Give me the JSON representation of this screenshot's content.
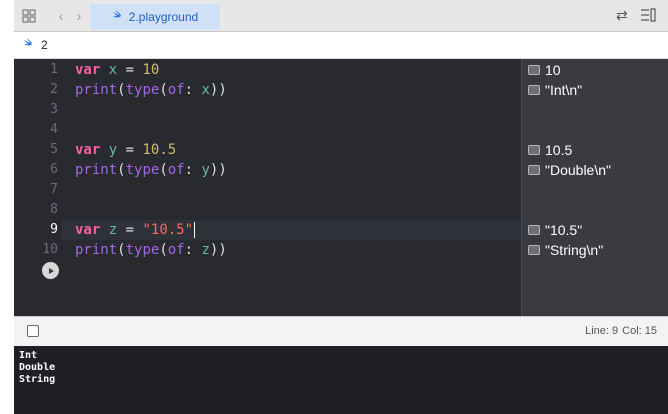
{
  "tab": {
    "title": "2.playground"
  },
  "breadcrumb": {
    "label": "2"
  },
  "editor": {
    "line_numbers": [
      "1",
      "2",
      "3",
      "4",
      "5",
      "6",
      "7",
      "8",
      "9",
      "10"
    ],
    "current_line": 9,
    "tokens": {
      "var": "var",
      "print": "print",
      "type": "type",
      "of": "of",
      "x": "x",
      "y": "y",
      "z": "z",
      "eq": " = ",
      "open": "(",
      "colon_space": ": ",
      "close": "))",
      "val_x": "10",
      "val_y": "10.5",
      "val_z": "\"10.5\""
    }
  },
  "results": {
    "r1": "10",
    "r2": "\"Int\\n\"",
    "r5": "10.5",
    "r6": "\"Double\\n\"",
    "r9": "\"10.5\"",
    "r10": "\"String\\n\""
  },
  "status": {
    "line_label": "Line: 9",
    "col_label": "Col: 15"
  },
  "console": {
    "lines": [
      "Int",
      "Double",
      "String"
    ]
  },
  "colors": {
    "keyword": "#fc5fa3",
    "identifier": "#67b7a4",
    "function": "#a167e6",
    "number": "#d0bf69",
    "string": "#fc6a5d",
    "editor_bg": "#292a30",
    "results_bg": "#3a3b40",
    "accent": "#1f5fbf"
  },
  "icons": [
    "grid-icon",
    "chevron-left-icon",
    "chevron-right-icon",
    "swift-icon",
    "swap-icon",
    "editor-options-icon",
    "run-icon",
    "result-quicklook-icon",
    "debug-area-toggle-icon"
  ]
}
